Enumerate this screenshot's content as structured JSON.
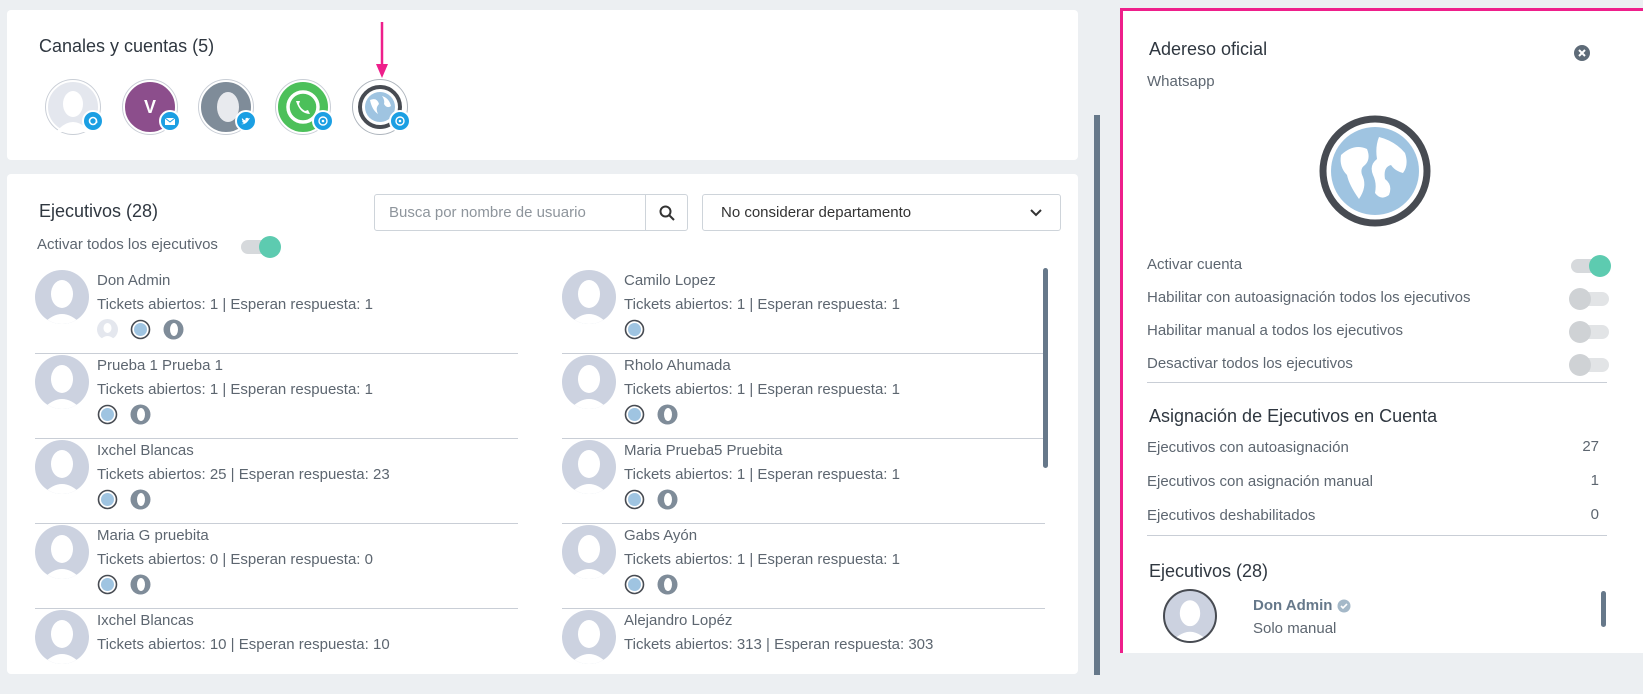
{
  "channels": {
    "title": "Canales y cuentas (5)",
    "items": [
      {
        "name": "channel-generic",
        "badge": "at-icon"
      },
      {
        "name": "channel-v",
        "letter": "V",
        "badge": "mail-icon"
      },
      {
        "name": "channel-twitter",
        "badge": "twitter-icon"
      },
      {
        "name": "channel-whatsapp",
        "badge": "whatsapp-icon"
      },
      {
        "name": "channel-globe",
        "badge": "whatsapp-icon"
      }
    ]
  },
  "executives": {
    "title": "Ejecutivos (28)",
    "search_placeholder": "Busca por nombre de usuario",
    "department_select": "No considerar departamento",
    "activate_all_label": "Activar todos los ejecutivos",
    "left": [
      {
        "name": "Don Admin",
        "stats": "Tickets abiertos: 1 |  Esperan respuesta: 1"
      },
      {
        "name": "Prueba 1 Prueba 1",
        "stats": "Tickets abiertos: 1 |  Esperan respuesta: 1"
      },
      {
        "name": "Ixchel Blancas",
        "stats": "Tickets abiertos: 25 |  Esperan respuesta: 23"
      },
      {
        "name": "Maria G pruebita",
        "stats": "Tickets abiertos: 0 |  Esperan respuesta: 0"
      },
      {
        "name": "Ixchel Blancas",
        "stats": "Tickets abiertos: 10 |  Esperan respuesta: 10"
      }
    ],
    "right": [
      {
        "name": "Camilo Lopez",
        "stats": "Tickets abiertos: 1 |  Esperan respuesta: 1"
      },
      {
        "name": "Rholo Ahumada",
        "stats": "Tickets abiertos: 1 |  Esperan respuesta: 1"
      },
      {
        "name": "Maria Prueba5 Pruebita",
        "stats": "Tickets abiertos: 1 |  Esperan respuesta: 1"
      },
      {
        "name": "Gabs Ayón",
        "stats": "Tickets abiertos: 1 |  Esperan respuesta: 1"
      },
      {
        "name": "Alejandro Lopéz",
        "stats": "Tickets abiertos: 313 |  Esperan respuesta: 303"
      }
    ]
  },
  "panel": {
    "title": "Adereso oficial",
    "subtitle": "Whatsapp",
    "toggles": [
      {
        "label": "Activar cuenta",
        "on": true
      },
      {
        "label": "Habilitar con autoasignación todos los ejecutivos",
        "on": false
      },
      {
        "label": "Habilitar manual a todos los ejecutivos",
        "on": false
      },
      {
        "label": "Desactivar todos los ejecutivos",
        "on": false
      }
    ],
    "assignment_title": "Asignación de Ejecutivos en Cuenta",
    "assignment": [
      {
        "label": "Ejecutivos con autoasignación",
        "value": "27"
      },
      {
        "label": "Ejecutivos con asignación manual",
        "value": "1"
      },
      {
        "label": "Ejecutivos deshabilitados",
        "value": "0"
      }
    ],
    "executives_title": "Ejecutivos (28)",
    "executive": {
      "name": "Don Admin",
      "mode": "Solo manual"
    }
  },
  "colors": {
    "accent": "#5dcbb0",
    "highlight": "#ee1f8b",
    "badge": "#1b9fe3"
  }
}
